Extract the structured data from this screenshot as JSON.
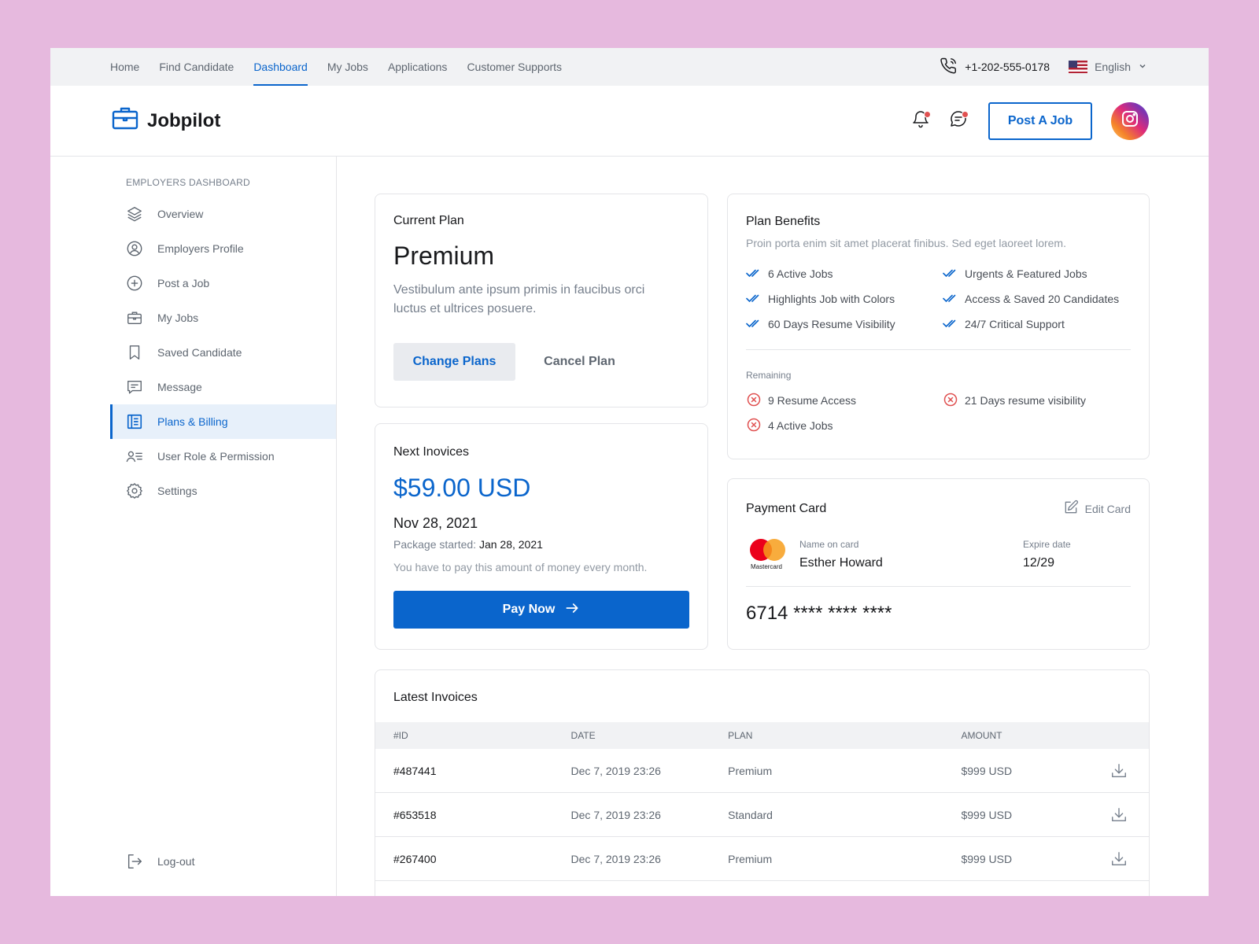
{
  "topnav": {
    "items": [
      "Home",
      "Find Candidate",
      "Dashboard",
      "My Jobs",
      "Applications",
      "Customer Supports"
    ],
    "active": "Dashboard",
    "phone": "+1-202-555-0178",
    "language": "English"
  },
  "header": {
    "logo": "Jobpilot",
    "post_job": "Post A Job"
  },
  "sidebar": {
    "title": "EMPLOYERS DASHBOARD",
    "items": [
      {
        "label": "Overview",
        "icon": "layers-icon"
      },
      {
        "label": "Employers Profile",
        "icon": "user-circle-icon"
      },
      {
        "label": "Post a Job",
        "icon": "plus-circle-icon"
      },
      {
        "label": "My Jobs",
        "icon": "briefcase-icon"
      },
      {
        "label": "Saved Candidate",
        "icon": "bookmark-icon"
      },
      {
        "label": "Message",
        "icon": "message-icon"
      },
      {
        "label": "Plans & Billing",
        "icon": "billing-icon",
        "active": true
      },
      {
        "label": "User Role & Permission",
        "icon": "user-list-icon"
      },
      {
        "label": "Settings",
        "icon": "gear-icon"
      }
    ],
    "logout": "Log-out"
  },
  "current_plan": {
    "title": "Current Plan",
    "plan": "Premium",
    "description": "Vestibulum ante ipsum primis in faucibus orci luctus et ultrices posuere.",
    "change": "Change Plans",
    "cancel": "Cancel Plan"
  },
  "next_invoice": {
    "title": "Next Inovices",
    "amount": "$59.00 USD",
    "date": "Nov 28, 2021",
    "started_label": "Package started: ",
    "started_date": "Jan 28, 2021",
    "note": "You have to pay this amount of money every month.",
    "pay": "Pay Now"
  },
  "plan_benefits": {
    "title": "Plan Benefits",
    "subtitle": "Proin porta enim sit amet placerat finibus. Sed eget laoreet lorem.",
    "benefits": [
      "6 Active Jobs",
      "Urgents & Featured Jobs",
      "Highlights Job with Colors",
      "Access & Saved 20 Candidates",
      "60 Days Resume Visibility",
      "24/7 Critical Support"
    ],
    "remaining_label": "Remaining",
    "remaining": [
      "9 Resume Access",
      "21 Days resume visibility",
      "4 Active Jobs"
    ]
  },
  "payment_card": {
    "title": "Payment Card",
    "edit": "Edit Card",
    "brand": "Mastercard",
    "name_label": "Name on card",
    "name": "Esther Howard",
    "expire_label": "Expire date",
    "expire": "12/29",
    "number_prefix": "6714",
    "number_mask": "**** **** ****"
  },
  "invoices": {
    "title": "Latest Invoices",
    "columns": [
      "#ID",
      "DATE",
      "PLAN",
      "AMOUNT"
    ],
    "rows": [
      {
        "id": "#487441",
        "date": "Dec 7, 2019 23:26",
        "plan": "Premium",
        "amount": "$999 USD"
      },
      {
        "id": "#653518",
        "date": "Dec 7, 2019 23:26",
        "plan": "Standard",
        "amount": "$999 USD"
      },
      {
        "id": "#267400",
        "date": "Dec 7, 2019 23:26",
        "plan": "Premium",
        "amount": "$999 USD"
      }
    ]
  },
  "colors": {
    "accent": "#0A65CC",
    "background": "#E6B9DE",
    "error": "#E05151"
  }
}
